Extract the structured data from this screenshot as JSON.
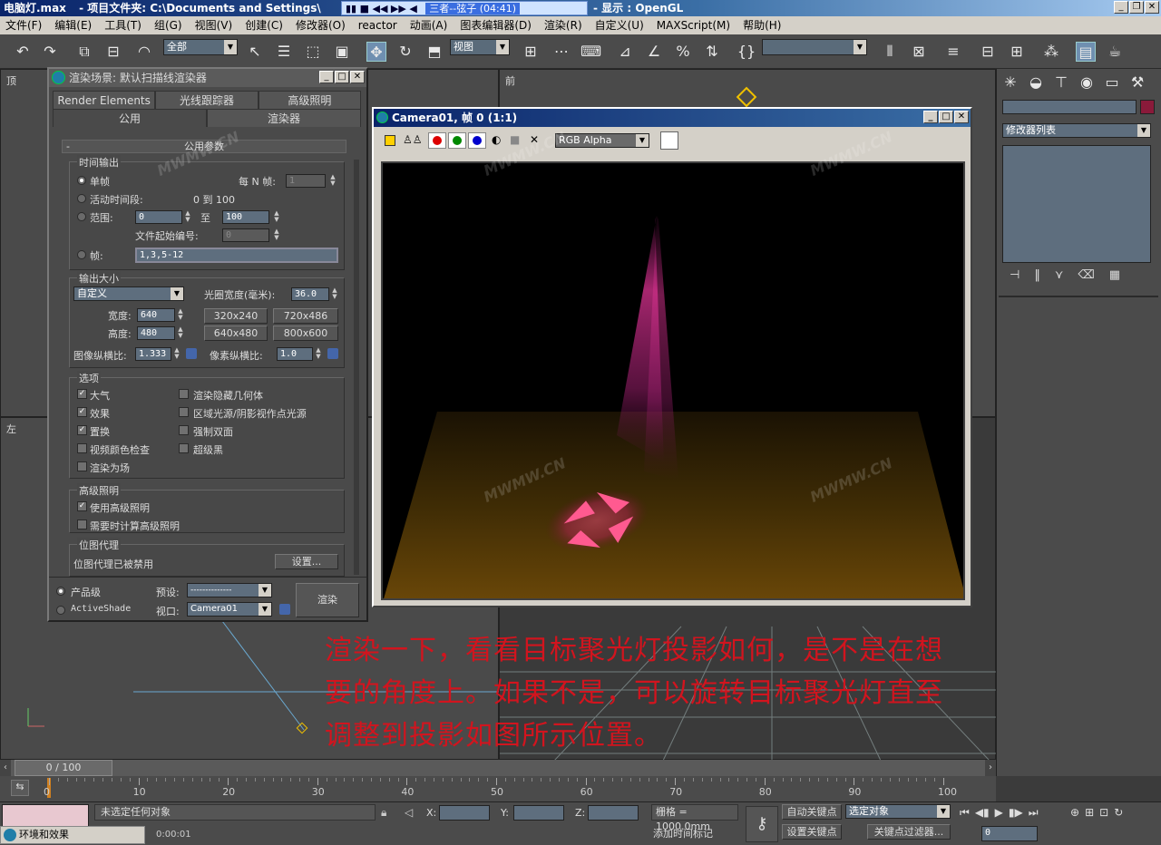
{
  "titlebar": {
    "file": "电脑灯.max",
    "project": "- 项目文件夹: C:\\Documents and Settings\\",
    "song": "三者--弦子 (04:41)",
    "display": "- 显示 : OpenGL"
  },
  "menu": [
    "文件(F)",
    "编辑(E)",
    "工具(T)",
    "组(G)",
    "视图(V)",
    "创建(C)",
    "修改器(O)",
    "reactor",
    "动画(A)",
    "图表编辑器(D)",
    "渲染(R)",
    "自定义(U)",
    "MAXScript(M)",
    "帮助(H)"
  ],
  "toolbar": {
    "selection_filter": "全部",
    "ref_coord": "视图",
    "named_sel": ""
  },
  "viewports": {
    "top": "顶",
    "front": "前",
    "left": "左"
  },
  "render_dialog": {
    "title": "渲染场景: 默认扫描线渲染器",
    "tabs_top": [
      "Render Elements",
      "光线跟踪器",
      "高级照明"
    ],
    "tabs_bottom": [
      "公用",
      "渲染器"
    ],
    "rollout": "公用参数",
    "time_output": {
      "title": "时间输出",
      "single": "单帧",
      "every_n": "每 N 帧:",
      "every_n_value": "1",
      "active_segment": "活动时间段:",
      "active_range": "0 到 100",
      "range": "范围:",
      "range_from": "0",
      "range_to_label": "至",
      "range_to": "100",
      "file_start": "文件起始编号:",
      "file_start_value": "0",
      "frames": "帧:",
      "frames_value": "1,3,5-12"
    },
    "output_size": {
      "title": "输出大小",
      "preset": "自定义",
      "aperture": "光圈宽度(毫米):",
      "aperture_value": "36.0",
      "width_label": "宽度:",
      "width": "640",
      "height_label": "高度:",
      "height": "480",
      "presets": [
        "320x240",
        "720x486",
        "640x480",
        "800x600"
      ],
      "img_aspect_label": "图像纵横比:",
      "img_aspect": "1.333",
      "pix_aspect_label": "像素纵横比:",
      "pix_aspect": "1.0"
    },
    "options": {
      "title": "选项",
      "items_left": [
        {
          "label": "大气",
          "checked": true
        },
        {
          "label": "效果",
          "checked": true
        },
        {
          "label": "置换",
          "checked": true
        },
        {
          "label": "视频颜色检查",
          "checked": false
        },
        {
          "label": "渲染为场",
          "checked": false
        }
      ],
      "items_right": [
        {
          "label": "渲染隐藏几何体",
          "checked": false
        },
        {
          "label": "区域光源/阴影视作点光源",
          "checked": false
        },
        {
          "label": "强制双面",
          "checked": false
        },
        {
          "label": "超级黑",
          "checked": false
        }
      ]
    },
    "advanced_lighting": {
      "title": "高级照明",
      "use": "使用高级照明",
      "compute": "需要时计算高级照明"
    },
    "bitmap_proxy": {
      "title": "位图代理",
      "status": "位图代理已被禁用",
      "setup": "设置..."
    },
    "bottom": {
      "production": "产品级",
      "activeshade": "ActiveShade",
      "preset_label": "预设:",
      "preset_value": "--------------",
      "viewport_label": "视口:",
      "viewport_value": "Camera01",
      "render": "渲染"
    }
  },
  "camera_window": {
    "title": "Camera01, 帧 0 (1:1)",
    "channel": "RGB Alpha"
  },
  "cmd_panel": {
    "modifier_list": "修改器列表"
  },
  "overlay": [
    "渲染一下，看看目标聚光灯投影如何，是不是在想",
    "要的角度上。如果不是，可以旋转目标聚光灯直至",
    "调整到投影如图所示位置。"
  ],
  "timeline": {
    "counter": "0 / 100",
    "ticks": [
      "0",
      "10",
      "20",
      "30",
      "40",
      "50",
      "60",
      "70",
      "80",
      "90",
      "100"
    ]
  },
  "status": {
    "selected": "未选定任何对象",
    "x": "X:",
    "y": "Y:",
    "z": "Z:",
    "grid": "栅格 = 1000.0mm",
    "auto_key": "自动关键点",
    "set_key": "设置关键点",
    "selected_obj": "选定对象",
    "key_filter": "关键点过滤器...",
    "add_time_tag": "添加时间标记",
    "frame": "0",
    "taskbar": "环境和效果",
    "time": "0:00:01"
  },
  "watermark": "MWMW.CN"
}
